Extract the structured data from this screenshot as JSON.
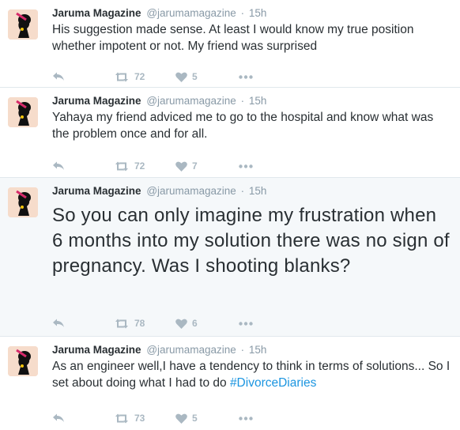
{
  "tweets": [
    {
      "author_name": "Jaruma Magazine",
      "handle": "@jarumamagazine",
      "separator": "·",
      "time": "15h",
      "text": "His suggestion made sense. At least I would know my true position whether impotent or not. My friend was surprised",
      "retweets": "72",
      "likes": "5"
    },
    {
      "author_name": "Jaruma Magazine",
      "handle": "@jarumamagazine",
      "separator": "·",
      "time": "15h",
      "text": "Yahaya my friend adviced me to go to the hospital and know what was the problem once and for all.",
      "retweets": "72",
      "likes": "7"
    },
    {
      "author_name": "Jaruma Magazine",
      "handle": "@jarumamagazine",
      "separator": "·",
      "time": "15h",
      "text": "So you can only imagine my frustration when 6 months into my solution there was no sign of pregnancy. Was I shooting blanks?",
      "retweets": "78",
      "likes": "6"
    },
    {
      "author_name": "Jaruma Magazine",
      "handle": "@jarumamagazine",
      "separator": "·",
      "time": "15h",
      "text": "As an engineer well,I have a tendency to think in terms of solutions... So I set about doing what I had to do",
      "hashtag": "#DivorceDiaries",
      "retweets": "73",
      "likes": "5"
    }
  ],
  "colors": {
    "name": "#292f33",
    "secondary": "#8899a6",
    "action": "#aab8c2",
    "link": "#1b95e0",
    "highlight_bg": "#f5f8fa",
    "avatar_bg": "#f4dccd"
  },
  "icons": {
    "avatar": "woman-silhouette-logo",
    "reply": "reply-icon",
    "retweet": "retweet-icon",
    "like": "heart-icon",
    "more": "more-dots-icon"
  }
}
